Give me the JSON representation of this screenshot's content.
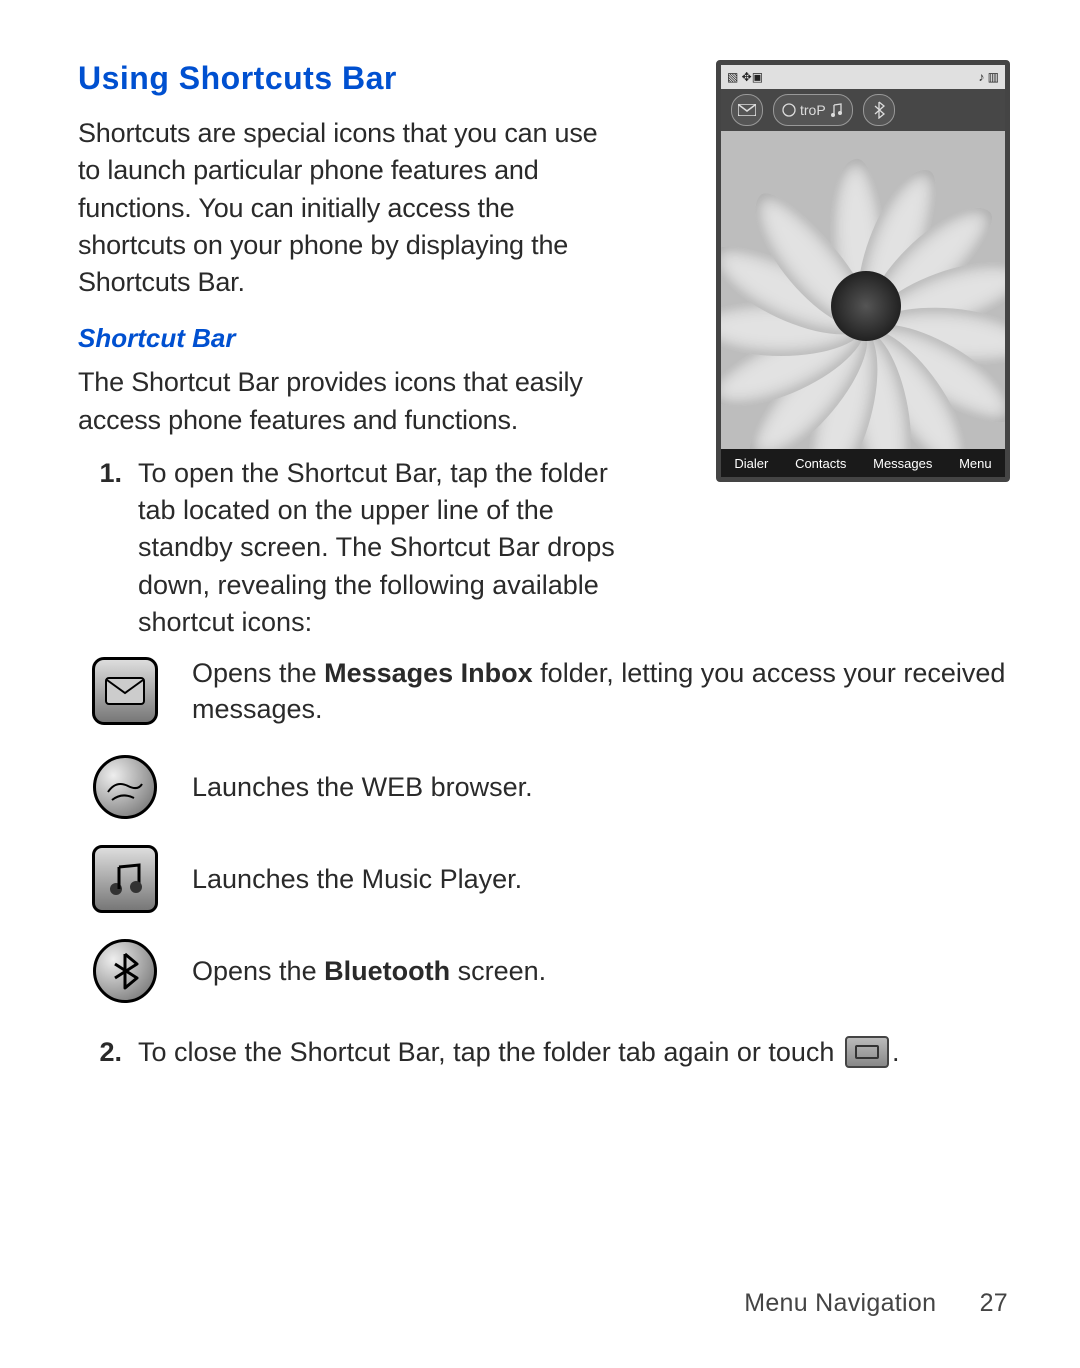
{
  "headings": {
    "main": "Using Shortcuts Bar",
    "sub": "Shortcut Bar"
  },
  "intro": "Shortcuts are special icons that you can use to launch particular phone features and functions. You can initially access the shortcuts on your phone by displaying the Shortcuts Bar.",
  "shortcut_intro": "The Shortcut Bar provides icons that easily access phone features and functions.",
  "steps": {
    "one_num": "1.",
    "one_text": "To open the Shortcut Bar, tap the folder tab located on the upper line of the standby screen. The Shortcut Bar drops down, revealing the following available shortcut icons:",
    "two_num": "2.",
    "two_text_before": "To close the Shortcut Bar, tap the folder tab again or touch ",
    "two_text_after": "."
  },
  "shortcut_rows": {
    "messages_before": "Opens the ",
    "messages_bold": "Messages Inbox",
    "messages_after": " folder, letting you access your received messages.",
    "web": "Launches the WEB browser.",
    "music": "Launches the Music Player.",
    "bt_before": "Opens the ",
    "bt_bold": "Bluetooth",
    "bt_after": " screen."
  },
  "phone": {
    "pill_label": "troP",
    "softkeys": [
      "Dialer",
      "Contacts",
      "Messages",
      "Menu"
    ]
  },
  "footer": {
    "chapter": "Menu Navigation",
    "page": "27"
  }
}
